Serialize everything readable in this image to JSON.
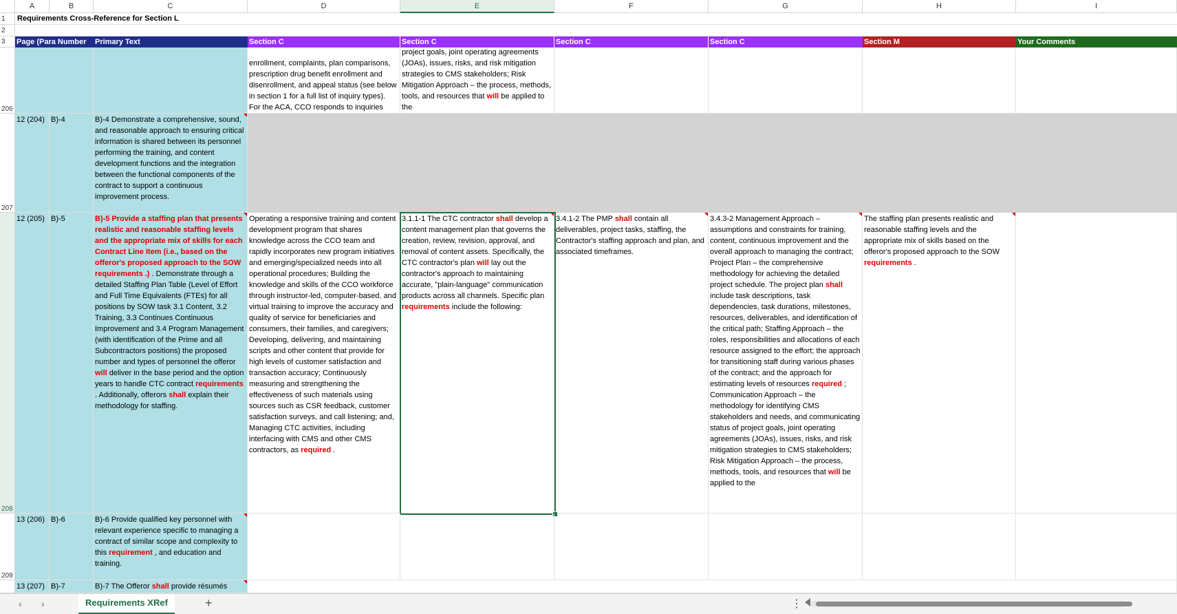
{
  "sheet": {
    "columns": [
      "A",
      "B",
      "C",
      "D",
      "E",
      "F",
      "G",
      "H",
      "I"
    ],
    "row_numbers": [
      "1",
      "2",
      "3",
      "206",
      "207",
      "208",
      "209"
    ],
    "title": "Requirements Cross-Reference for Section L",
    "headers": {
      "a": "Page (Para Number",
      "c": "Primary Text",
      "d": "Section C",
      "e": "Section C",
      "f": "Section C",
      "g": "Section C",
      "h": "Section M",
      "i": "Your Comments"
    },
    "header_colors": {
      "ac": "#1f2d8a",
      "section_c": "#9b30ff",
      "section_m": "#b22222",
      "comments": "#1e6b1e"
    },
    "row206": {
      "d_parts": [
        "enrollment, complaints, plan comparisons, prescription drug benefit enrollment and disenrollment, and appeal status (see below in section 1 for a full list of inquiry types). For the ACA, CCO responds to inquiries"
      ],
      "e_parts": [
        "project goals, joint operating agreements (JOAs), issues, risks, and risk mitigation strategies to CMS stakeholders; Risk Mitigation Approach – the process, methods, tools, and resources that ",
        "will",
        " be applied to the"
      ]
    },
    "row207": {
      "a": "12 (204)",
      "b": "B)-4",
      "c": "B)-4 Demonstrate a comprehensive, sound, and reasonable approach to ensuring critical information is shared between its personnel performing the training, and content development functions and the integration between the functional components of the contract to support a continuous improvement process."
    },
    "row208": {
      "a": "12 (205)",
      "b": "B)-5",
      "c_red": "B)-5 Provide a staffing plan that presents realistic and reasonable staffing levels and the appropriate mix of skills for each Contract Line Item (i.e., based on the offeror's proposed approach to the SOW requirements .)",
      "c_parts": [
        " . Demonstrate through a detailed Staffing Plan Table (Level of Effort and Full Time Equivalents (FTEs) for all positions by SOW task 3.1 Content, 3.2 Training, 3.3 Continues Continuous Improvement and 3.4 Program Management (with identification of the Prime and all Subcontractors positions) the proposed number and types of personnel the offeror ",
        "will",
        " deliver in the base period and the option years to handle CTC contract ",
        "requirements",
        " . Additionally, offerors ",
        "shall",
        " explain their methodology for staffing."
      ],
      "d_parts": [
        "Operating a responsive training and content development program that shares knowledge across the CCO team and rapidly incorporates new program initiatives and emerging/specialized needs into all operational procedures; Building the knowledge and skills of the CCO workforce through instructor-led, computer-based, and virtual training to improve the accuracy and quality of service for beneficiaries and consumers, their families, and caregivers; Developing, delivering, and maintaining scripts and other content that provide for high levels of customer satisfaction and transaction accuracy; Continuously measuring and strengthening the effectiveness of such materials using sources such as CSR feedback, customer satisfaction surveys, and call listening; and, Managing CTC activities, including interfacing with CMS and other CMS contractors, as ",
        "required",
        " ."
      ],
      "e_parts": [
        "3.1.1-1 The CTC contractor ",
        "shall",
        " develop a content management plan that governs the creation, review, revision, approval, and removal of content assets. Specifically, the CTC contractor's plan ",
        "will",
        " lay out the contractor's approach to maintaining accurate, \"plain-language\" communication products across all channels. Specific plan ",
        "requirements",
        " include the following:"
      ],
      "f_parts": [
        "3.4.1-2 The PMP ",
        "shall",
        " contain all deliverables, project tasks, staffing, the Contractor's staffing approach and plan, and associated timeframes."
      ],
      "g_parts": [
        "3.4.3-2 Management Approach – assumptions and constraints for training, content, continuous improvement and the overall approach to managing the contract; Project Plan – the comprehensive methodology for achieving the detailed project schedule. The project plan ",
        "shall",
        " include task descriptions, task dependencies, task durations, milestones, resources, deliverables, and identification of the critical path; Staffing Approach – the roles, responsibilities and allocations of each resource assigned to the effort; the approach for transitioning staff during various phases of the contract; and the approach for estimating levels of resources ",
        "required",
        " ; Communication Approach – the methodology for identifying CMS stakeholders and needs, and communicating status of project goals, joint operating agreements (JOAs), issues, risks, and risk mitigation strategies to CMS stakeholders; Risk Mitigation Approach – the process, methods, tools, and resources that ",
        "will",
        " be applied to the"
      ],
      "h_parts": [
        "The staffing plan presents realistic and reasonable staffing levels and the appropriate mix of skills based on the offeror's proposed approach to the SOW ",
        "requirements",
        " ."
      ]
    },
    "row209": {
      "a": "13 (206)",
      "b": "B)-6",
      "c_parts": [
        "B)-6 Provide qualified key personnel with relevant experience specific to managing a contract of similar scope and complexity to this ",
        "requirement",
        " , and education and training."
      ]
    },
    "row210": {
      "a": "13 (207)",
      "b": "B)-7",
      "c_parts": [
        "B)-7 The Offeror ",
        "shall",
        " provide résumés"
      ]
    }
  },
  "tabs": {
    "prev_icon": "chevron-left-icon",
    "next_icon": "chevron-right-icon",
    "active_tab": "Requirements XRef",
    "add_icon": "plus-icon",
    "more_icon": "vertical-dots-icon"
  }
}
